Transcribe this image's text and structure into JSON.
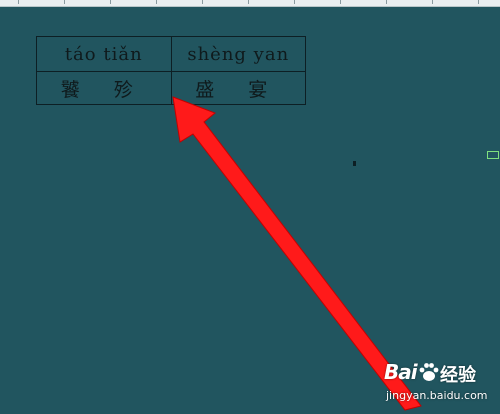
{
  "table": {
    "row1": [
      "táo tiǎn",
      "shèng yan"
    ],
    "row2": [
      "饕 殄",
      "盛 宴"
    ]
  },
  "watermark": {
    "logo_text": "Bai",
    "brand_text": "经验",
    "url": "jingyan.baidu.com"
  },
  "colors": {
    "background": "#21555f",
    "arrow": "#ff1a1a",
    "marker": "#7fe07f"
  },
  "icons": {
    "arrow": "red-arrow-icon",
    "paw": "baidu-paw-icon"
  }
}
